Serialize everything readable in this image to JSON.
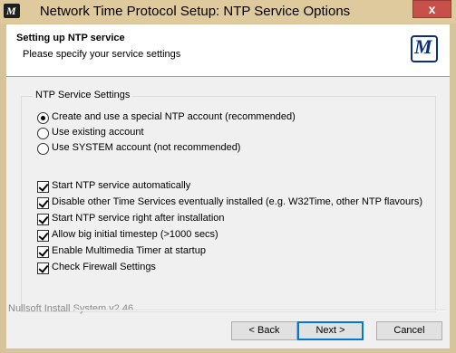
{
  "window": {
    "title": "Network Time Protocol Setup: NTP Service Options",
    "close_glyph": "x",
    "app_icon_glyph": "M"
  },
  "header": {
    "title": "Setting up NTP service",
    "subtitle": "Please specify your service settings",
    "logo_glyph": "M"
  },
  "group": {
    "label": "NTP Service Settings",
    "radios": [
      {
        "label": "Create and use a special NTP account  (recommended)",
        "selected": true
      },
      {
        "label": "Use existing account",
        "selected": false
      },
      {
        "label": "Use SYSTEM account (not recommended)",
        "selected": false
      }
    ],
    "checkboxes": [
      {
        "label": "Start NTP service automatically",
        "checked": true
      },
      {
        "label": "Disable other Time Services eventually installed (e.g. W32Time, other NTP flavours)",
        "checked": true
      },
      {
        "label": "Start NTP service right after installation",
        "checked": true
      },
      {
        "label": "Allow big initial timestep (>1000 secs)",
        "checked": true
      },
      {
        "label": "Enable Multimedia Timer at startup",
        "checked": true
      },
      {
        "label": "Check Firewall Settings",
        "checked": true
      }
    ]
  },
  "footer": {
    "brand": "Nullsoft Install System v2.46"
  },
  "buttons": {
    "back": "< Back",
    "next": "Next >",
    "cancel": "Cancel"
  },
  "colors": {
    "titlebar": "#dfca9e",
    "close": "#c7504b",
    "focus": "#0078d7"
  }
}
